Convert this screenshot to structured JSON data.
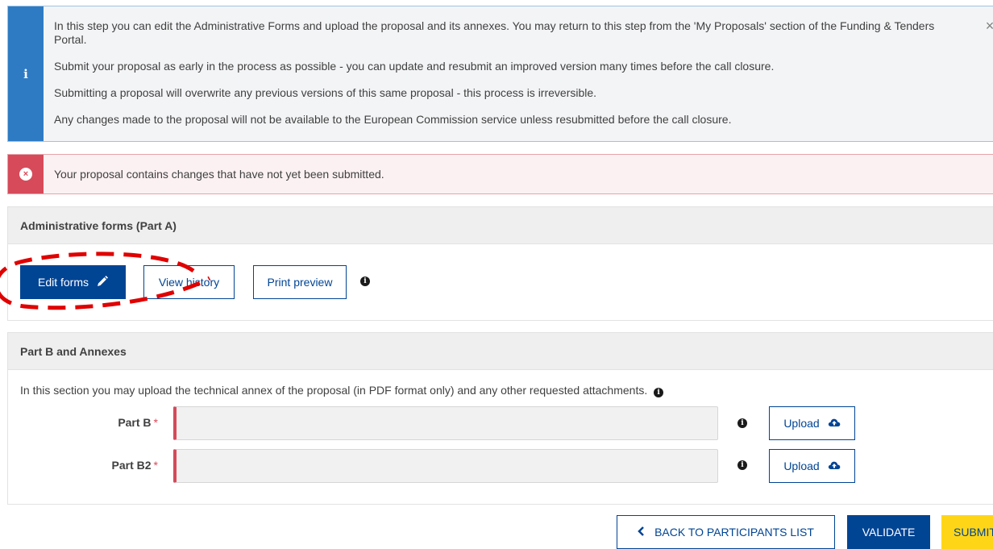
{
  "info_alert": {
    "lines": [
      "In this step you can edit the Administrative Forms and upload the proposal and its annexes. You may return to this step from the 'My Proposals' section of the Funding & Tenders Portal.",
      "Submit your proposal as early in the process as possible - you can update and resubmit an improved version many times before the call closure.",
      "Submitting a proposal will overwrite any previous versions of this same proposal - this process is irreversible.",
      "Any changes made to the proposal will not be available to the European Commission service unless resubmitted before the call closure."
    ],
    "close_glyph": "×",
    "info_glyph": "i"
  },
  "error_alert": {
    "message": "Your proposal contains changes that have not yet been submitted.",
    "glyph": "×"
  },
  "part_a": {
    "title": "Administrative forms (Part A)",
    "edit_label": "Edit forms",
    "history_label": "View history",
    "preview_label": "Print preview"
  },
  "part_b": {
    "title": "Part B and Annexes",
    "description": "In this section you may upload the technical annex of the proposal (in PDF format only) and any other requested attachments.",
    "fields": [
      {
        "label": "Part B",
        "required_mark": "*",
        "upload_label": "Upload"
      },
      {
        "label": "Part B2",
        "required_mark": "*",
        "upload_label": "Upload"
      }
    ]
  },
  "footer": {
    "back_label": "BACK TO PARTICIPANTS LIST",
    "validate_label": "VALIDATE",
    "submit_label": "SUBMIT"
  },
  "colors": {
    "primary": "#004494",
    "info": "#2e7bc4",
    "error": "#d64a5a",
    "warning": "#ffd617",
    "annotation": "#e00000"
  },
  "icons": {
    "edit": "pencil-icon",
    "upload": "cloud-upload-icon",
    "info": "info-circle-icon",
    "back": "chevron-left-icon"
  }
}
